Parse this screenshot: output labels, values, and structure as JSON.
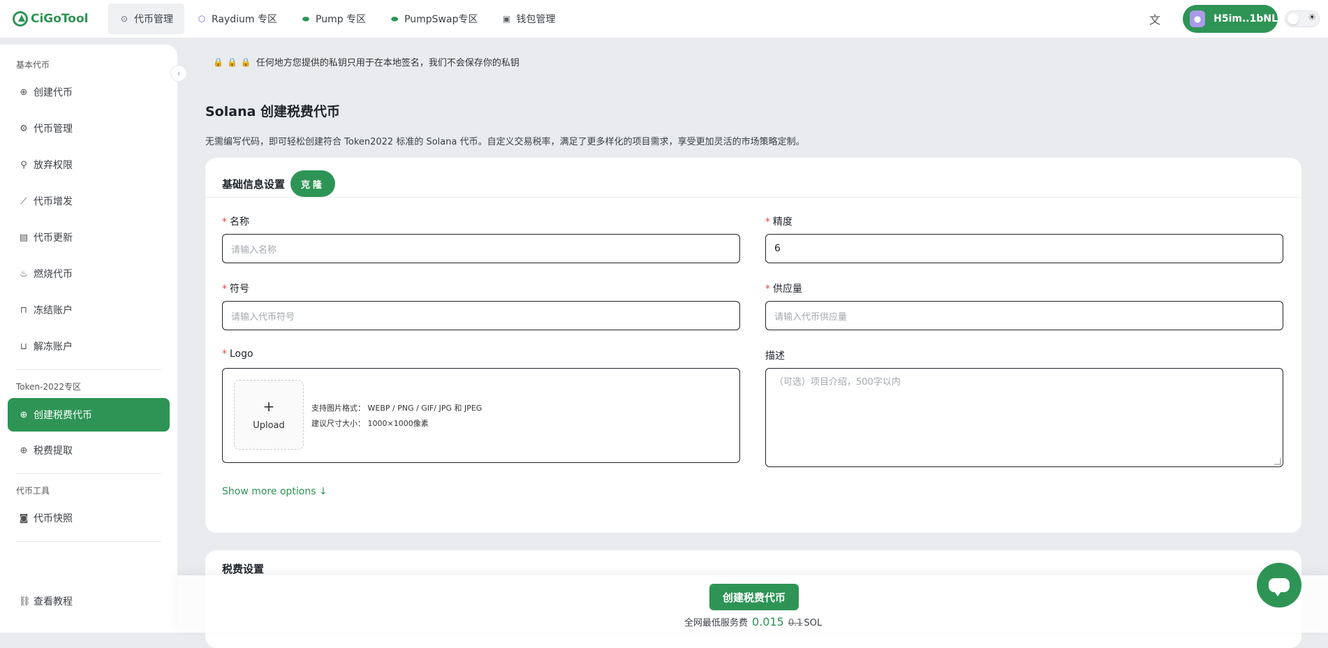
{
  "app": {
    "logo_text": "CiGoTool"
  },
  "nav": {
    "items": [
      {
        "label": "代币管理",
        "icon": "dollar-circle-icon"
      },
      {
        "label": "Raydium 专区",
        "icon": "raydium-icon"
      },
      {
        "label": "Pump 专区",
        "icon": "pill-icon"
      },
      {
        "label": "PumpSwap专区",
        "icon": "pill-icon"
      },
      {
        "label": "钱包管理",
        "icon": "wallet-icon"
      }
    ]
  },
  "header": {
    "wallet_label": "H5im..1bNL"
  },
  "sidebar": {
    "section_basic": "基本代币",
    "basic_items": [
      {
        "label": "创建代币"
      },
      {
        "label": "代币管理"
      },
      {
        "label": "放弃权限"
      },
      {
        "label": "代币增发"
      },
      {
        "label": "代币更新"
      },
      {
        "label": "燃烧代币"
      },
      {
        "label": "冻结账户"
      },
      {
        "label": "解冻账户"
      }
    ],
    "section_token2022": "Token-2022专区",
    "token2022_items": [
      {
        "label": "创建税费代币"
      },
      {
        "label": "税费提取"
      }
    ],
    "section_tools": "代币工具",
    "tools_items": [
      {
        "label": "代币快照"
      }
    ],
    "tutorial_label": "查看教程"
  },
  "main": {
    "notice": "任何地方您提供的私钥只用于在本地签名，我们不会保存你的私钥",
    "title": "Solana 创建税费代币",
    "description": "无需编写代码，即可轻松创建符合 Token2022 标准的 Solana 代币。自定义交易税率，满足了更多样化的项目需求，享受更加灵活的市场策略定制。"
  },
  "basic_form": {
    "section_title": "基础信息设置",
    "clone_label": "克隆",
    "name": {
      "label": "名称",
      "placeholder": "请输入名称"
    },
    "decimals": {
      "label": "精度",
      "value": "6"
    },
    "symbol": {
      "label": "符号",
      "placeholder": "请输入代币符号"
    },
    "supply": {
      "label": "供应量",
      "placeholder": "请输入代币供应量"
    },
    "logo": {
      "label": "Logo",
      "upload_label": "Upload",
      "format_hint": "支持图片格式： WEBP / PNG / GIF/ JPG 和 JPEG",
      "size_hint": "建议尺寸大小： 1000×1000像素"
    },
    "description": {
      "label": "描述",
      "placeholder": "（可选）项目介绍，500字以内"
    },
    "show_more": "Show more options ↓"
  },
  "tax_form": {
    "section_title": "税费设置"
  },
  "footer": {
    "create_label": "创建税费代币",
    "fee_prefix": "全网最低服务费",
    "fee_new": "0.015",
    "fee_old": "0.1",
    "fee_unit": "SOL"
  }
}
